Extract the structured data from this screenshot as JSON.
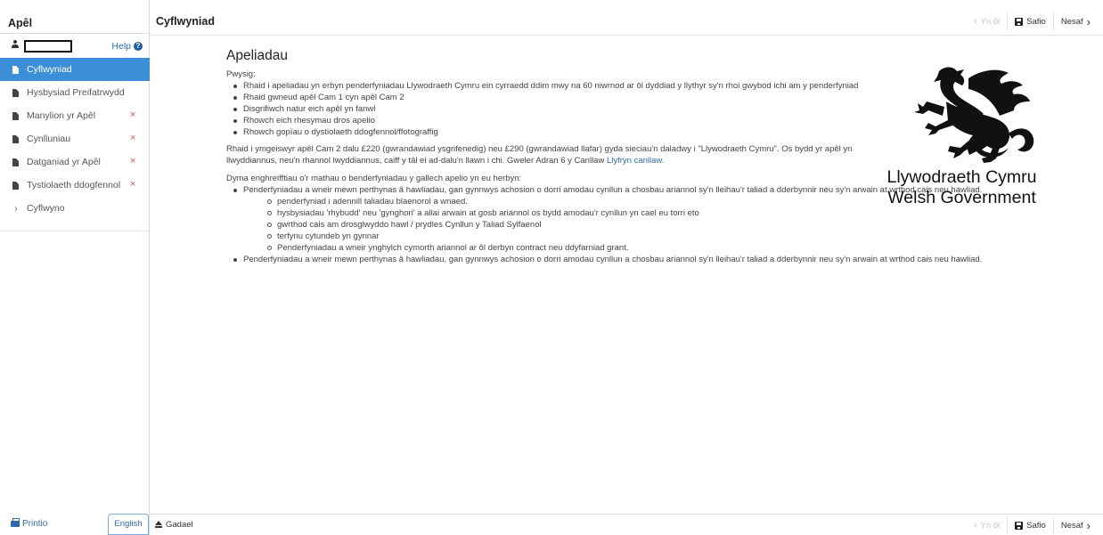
{
  "sidebar": {
    "title": "Apêl",
    "help_label": "Help",
    "items": [
      {
        "label": "Cyflwyniad",
        "active": true,
        "error": false
      },
      {
        "label": "Hysbysiad Preifatrwydd",
        "active": false,
        "error": false
      },
      {
        "label": "Manylion yr Apêl",
        "active": false,
        "error": true
      },
      {
        "label": "Cynlluniau",
        "active": false,
        "error": true
      },
      {
        "label": "Datganiad yr Apêl",
        "active": false,
        "error": true
      },
      {
        "label": "Tystiolaeth ddogfennol",
        "active": false,
        "error": true
      },
      {
        "label": "Cyflwyno",
        "active": false,
        "error": false
      }
    ],
    "error_mark": "×",
    "print_label": "Printio",
    "language_button": "English"
  },
  "header": {
    "title": "Cyflwyniad",
    "back_label": "Yn ôl",
    "save_label": "Safio",
    "next_label": "Nesaf"
  },
  "footer": {
    "exit_label": "Gadael",
    "back_label": "Yn ôl",
    "save_label": "Safio",
    "next_label": "Nesaf"
  },
  "main": {
    "heading": "Apeliadau",
    "important_label": "Pwysig:",
    "important_points": [
      "Rhaid i apeliadau yn erbyn penderfyniadau Llywodraeth Cymru ein cyrraedd ddim mwy na 60 niwrnod ar ôl dyddiad y llythyr sy'n rhoi gwybod ichi am y penderfyniad",
      "Rhaid gwneud apêl Cam 1 cyn apêl Cam 2",
      "Disgrifiwch natur eich apêl yn fanwl",
      "Rhowch eich rhesymau dros apelio",
      "Rhowch gopïau o dystiolaeth ddogfennol/ffotograffig"
    ],
    "fee_text": "Rhaid i ymgeiswyr apêl Cam 2 dalu £220 (gwrandawiad ysgrifenedig) neu £290 (gwrandawiad llafar) gyda sieciau'n daladwy i \"Llywodraeth Cymru\". Os bydd yr apêl yn llwyddiannus, neu'n rhannol lwyddiannus, caiff y tâl ei ad-dalu'n llawn i chi. Gweler Adran 6 y Canllaw ",
    "fee_link": "Llyfryn canllaw.",
    "examples_intro": "Dyma enghreifftiau o'r mathau o benderfyniadau y gallech apelio yn eu herbyn:",
    "example_main_1": "Penderfyniadau a wneir mewn perthynas â hawliadau, gan gynnwys achosion o dorri amodau cynllun a chosbau ariannol sy'n lleihau'r taliad a dderbynnir neu sy'n arwain at wrthod cais neu hawliad.",
    "example_subs": [
      "penderfyniad i adennill taliadau blaenorol a wnaed.",
      "hysbysiadau 'rhybudd' neu 'gynghori' a allai arwain at gosb ariannol os bydd amodau'r cynllun yn cael eu torri eto",
      "gwrthod cais am drosglwyddo hawl / prydles Cynllun y Taliad Sylfaenol",
      "terfynu cytundeb yn gynnar",
      "Penderfyniadau a wneir ynghylch cymorth ariannol ar ôl derbyn contract neu ddyfarniad grant."
    ],
    "example_main_2": "Penderfyniadau a wneir mewn perthynas â hawliadau, gan gynnwys achosion o dorri amodau cynllun a chosbau ariannol sy'n lleihau'r taliad a dderbynnir neu sy'n arwain at wrthod cais neu hawliad."
  },
  "logo": {
    "line1": "Llywodraeth Cymru",
    "line2": "Welsh Government"
  }
}
